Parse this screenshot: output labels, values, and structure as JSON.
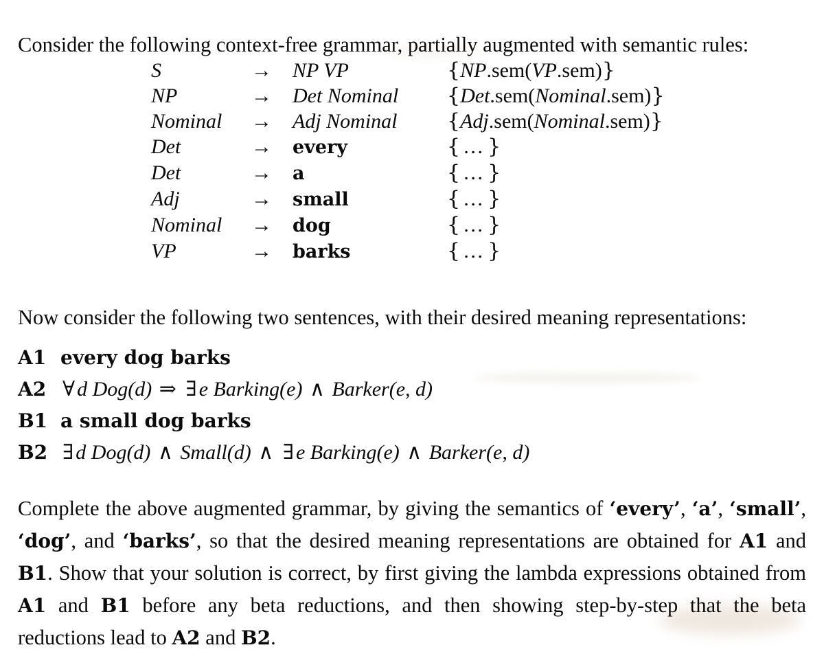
{
  "document": {
    "intro_paragraph": "Consider the following context-free grammar, partially augmented with semantic rules:",
    "middle_paragraph": "Now consider the following two sentences, with their desired meaning representations:",
    "final_paragraph_parts": {
      "p1": "Complete the above augmented grammar, by giving the semantics of ",
      "q1": "‘every’",
      "p2": ", ",
      "q2": "‘a’",
      "p3": ", ",
      "q3": "‘small’",
      "p4": ", ",
      "q4": "‘dog’",
      "p5": ", and ",
      "q5": "‘barks’",
      "p6": ", so that the desired meaning representations are obtained for ",
      "ref1": "A1",
      "p7": " and ",
      "ref2": "B1",
      "p8": ".  Show that your solution is correct, by first giving the lambda expressions obtained from ",
      "ref3": "A1",
      "p9": " and ",
      "ref4": "B1",
      "p10": " before any beta reductions, and then showing step-by-step that the beta reductions lead to ",
      "ref5": "A2",
      "p11": " and ",
      "ref6": "B2",
      "p12": "."
    }
  },
  "grammar": {
    "arrow": "→",
    "rules": [
      {
        "lhs": "S",
        "rhs": "NP VP",
        "rhs_terminal": false,
        "sem_kind": "expr",
        "sem_open": "{",
        "sem_head": "NP",
        "sem_dot": ".sem(",
        "sem_arg": "VP",
        "sem_argdot": ".sem)",
        "sem_close": "}"
      },
      {
        "lhs": "NP",
        "rhs": "Det Nominal",
        "rhs_terminal": false,
        "sem_kind": "expr",
        "sem_open": "{",
        "sem_head": "Det",
        "sem_dot": ".sem(",
        "sem_arg": "Nominal",
        "sem_argdot": ".sem)",
        "sem_close": "}"
      },
      {
        "lhs": "Nominal",
        "rhs": "Adj Nominal",
        "rhs_terminal": false,
        "sem_kind": "expr",
        "sem_open": "{",
        "sem_head": "Adj",
        "sem_dot": ".sem(",
        "sem_arg": "Nominal",
        "sem_argdot": ".sem)",
        "sem_close": "}"
      },
      {
        "lhs": "Det",
        "rhs": "every",
        "rhs_terminal": true,
        "sem_kind": "dots",
        "sem_open": "{",
        "sem_dots": "…",
        "sem_close": "}"
      },
      {
        "lhs": "Det",
        "rhs": "a",
        "rhs_terminal": true,
        "sem_kind": "dots",
        "sem_open": "{",
        "sem_dots": "…",
        "sem_close": "}"
      },
      {
        "lhs": "Adj",
        "rhs": "small",
        "rhs_terminal": true,
        "sem_kind": "dots",
        "sem_open": "{",
        "sem_dots": "…",
        "sem_close": "}"
      },
      {
        "lhs": "Nominal",
        "rhs": "dog",
        "rhs_terminal": true,
        "sem_kind": "dots",
        "sem_open": "{",
        "sem_dots": "…",
        "sem_close": "}"
      },
      {
        "lhs": "VP",
        "rhs": "barks",
        "rhs_terminal": true,
        "sem_kind": "dots",
        "sem_open": "{",
        "sem_dots": "…",
        "sem_close": "}"
      }
    ]
  },
  "sentences": [
    {
      "tag": "A1",
      "kind": "words",
      "text": "every dog barks"
    },
    {
      "tag": "A2",
      "kind": "formula",
      "segments": [
        {
          "t": "∀",
          "op": true
        },
        {
          "t": "d Dog(d) ",
          "op": false
        },
        {
          "t": "⇒",
          "op": true
        },
        {
          "t": " ",
          "op": false
        },
        {
          "t": "∃",
          "op": true
        },
        {
          "t": "e Barking(e)  ",
          "op": false
        },
        {
          "t": "∧",
          "op": true
        },
        {
          "t": " Barker(e, d)",
          "op": false
        }
      ],
      "plain": "∀d Dog(d) ⇒ ∃e Barking(e) ∧ Barker(e, d)"
    },
    {
      "tag": "B1",
      "kind": "words",
      "text": "a small dog barks"
    },
    {
      "tag": "B2",
      "kind": "formula",
      "segments": [
        {
          "t": "∃",
          "op": true
        },
        {
          "t": "d Dog(d) ",
          "op": false
        },
        {
          "t": "∧",
          "op": true
        },
        {
          "t": " Small(d) ",
          "op": false
        },
        {
          "t": "∧",
          "op": true
        },
        {
          "t": " ",
          "op": false
        },
        {
          "t": "∃",
          "op": true
        },
        {
          "t": "e Barking(e)  ",
          "op": false
        },
        {
          "t": "∧",
          "op": true
        },
        {
          "t": " Barker(e, d)",
          "op": false
        }
      ],
      "plain": "∃d Dog(d) ∧ Small(d) ∧ ∃e Barking(e) ∧ Barker(e, d)"
    }
  ],
  "colors": {
    "page_background": "#ffffff",
    "text": "#0b0b0b",
    "smudge": "#e2d6c4"
  }
}
